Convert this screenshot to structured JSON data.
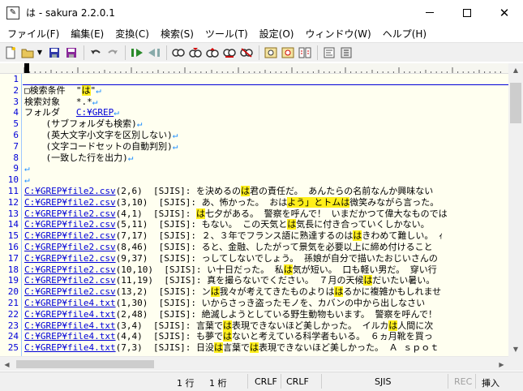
{
  "window": {
    "title": "は - sakura 2.2.0.1",
    "app_icon": "sakura-app-icon",
    "minimize_glyph": "",
    "maximize_glyph": "",
    "close_glyph": "✕"
  },
  "menu": [
    "ファイル(F)",
    "編集(E)",
    "変換(C)",
    "検索(S)",
    "ツール(T)",
    "設定(O)",
    "ウィンドウ(W)",
    "ヘルプ(H)"
  ],
  "toolbar_icons": [
    "new-file-icon",
    "open-folder-icon",
    "open-dropdown-icon",
    "save-icon",
    "save-all-icon",
    "undo-icon",
    "redo-icon",
    "jump-back-icon",
    "jump-forward-icon",
    "search-icon",
    "search-next-icon",
    "search-prev-icon",
    "replace-icon",
    "clear-mark-icon",
    "grep-icon",
    "grep-replace-icon",
    "compare-icon",
    "outline-icon",
    "settings-icon"
  ],
  "editor": {
    "line_numbers": [
      "1",
      "2",
      "3",
      "4",
      "5",
      "6",
      "7",
      "8",
      "9",
      "10",
      "11",
      "12",
      "13",
      "14",
      "15",
      "16",
      "17",
      "18",
      "19",
      "20",
      "21",
      "22",
      "23",
      "24",
      "25"
    ],
    "header_lines": [
      {
        "pre": "□検索条件  \"",
        "hl": "は",
        "post": "\"",
        "eol": "↵"
      },
      {
        "text": "検索対象   *.*",
        "eol": "↵"
      },
      {
        "label": "フォルダ   ",
        "path": "C:¥GREP",
        "eol": "↵"
      },
      {
        "text": "    (サブフォルダも検索)",
        "eol": "↵"
      },
      {
        "text": "    (英大文字小文字を区別しない)",
        "eol": "↵"
      },
      {
        "text": "    (文字コードセットの自動判別)",
        "eol": "↵"
      },
      {
        "text": "    (一致した行を出力)",
        "eol": "↵"
      },
      {
        "text": "",
        "eol": "↵"
      },
      {
        "text": "",
        "eol": "↵"
      }
    ],
    "results": [
      {
        "path": "C:¥GREP¥file2.csv",
        "pos": "(2,6)",
        "enc": "  [SJIS]: ",
        "segs": [
          "を決めるの",
          "は",
          "君の責任だ。 あんたらの名前なんか興味ない"
        ]
      },
      {
        "path": "C:¥GREP¥file2.csv",
        "pos": "(3,10)",
        "enc": "  [SJIS]: ",
        "segs": [
          "あ、怖かった。 おは",
          "よう」とトムは",
          "微笑みながら言った。"
        ]
      },
      {
        "path": "C:¥GREP¥file2.csv",
        "pos": "(4,1)",
        "enc": "  [SJIS]: ",
        "segs": [
          "",
          "は",
          "七夕がある。 警察を呼んで！ いまだかつて偉大なものでは"
        ]
      },
      {
        "path": "C:¥GREP¥file2.csv",
        "pos": "(5,11)",
        "enc": "  [SJIS]: ",
        "segs": [
          "もない。 この天気と",
          "は",
          "気長に付き合っていくしかない。"
        ]
      },
      {
        "path": "C:¥GREP¥file2.csv",
        "pos": "(7,17)",
        "enc": "  [SJIS]: ",
        "segs": [
          "２、３年でフランス語に熟達するのは",
          "は",
          "きわめて難しい。 ｨ"
        ]
      },
      {
        "path": "C:¥GREP¥file2.csv",
        "pos": "(8,46)",
        "enc": "  [SJIS]: ",
        "segs": [
          "ると、金融、したがって景気を必要以上に締め付けること"
        ]
      },
      {
        "path": "C:¥GREP¥file2.csv",
        "pos": "(9,37)",
        "enc": "  [SJIS]: ",
        "segs": [
          "っしてしないでしょう。 孫娘が自分で描いたおじいさんの"
        ]
      },
      {
        "path": "C:¥GREP¥file2.csv",
        "pos": "(10,10)",
        "enc": "  [SJIS]: ",
        "segs": [
          "い十日だった。 私",
          "は",
          "気が短い。 口も軽い男だ。 穿い行"
        ]
      },
      {
        "path": "C:¥GREP¥file2.csv",
        "pos": "(11,19)",
        "enc": "  [SJIS]: ",
        "segs": [
          "真を撮らないでください。 ７月の天候",
          "は",
          "だいたい暑い。"
        ]
      },
      {
        "path": "C:¥GREP¥file2.csv",
        "pos": "(13,2)",
        "enc": "  [SJIS]: ",
        "segs": [
          "ン",
          "は",
          "我々が考えてきたものよりは",
          "は",
          "るかに複雑かもしれませ"
        ]
      },
      {
        "path": "C:¥GREP¥file4.txt",
        "pos": "(1,30)",
        "enc": "  [SJIS]: ",
        "segs": [
          "いからさっき盗ったモノを、カバンの中から出しなさい"
        ]
      },
      {
        "path": "C:¥GREP¥file4.txt",
        "pos": "(2,48)",
        "enc": "  [SJIS]: ",
        "segs": [
          "絶滅しようとしている野生動物もいます。 警察を呼んで！"
        ]
      },
      {
        "path": "C:¥GREP¥file4.txt",
        "pos": "(3,4)",
        "enc": "  [SJIS]: ",
        "segs": [
          "言葉で",
          "は",
          "表現できないほど美しかった。 イルカ",
          "は",
          "人間に次"
        ]
      },
      {
        "path": "C:¥GREP¥file4.txt",
        "pos": "(4,4)",
        "enc": "  [SJIS]: ",
        "segs": [
          "も夢で",
          "は",
          "ないと考えている科学者もいる。 ６ヵ月靴を買っ"
        ]
      },
      {
        "path": "C:¥GREP¥file4.txt",
        "pos": "(7,3)",
        "enc": "  [SJIS]: ",
        "segs": [
          "日没",
          "は",
          "言葉で",
          "は",
          "表現できないほど美しかった。 Ａ ｓｐｏｔ"
        ]
      }
    ]
  },
  "status": {
    "row": "1 行",
    "col": "1 桁",
    "eol1": "CRLF",
    "eol2": "CRLF",
    "encoding": "SJIS",
    "rec": "REC",
    "insert": "挿入"
  }
}
